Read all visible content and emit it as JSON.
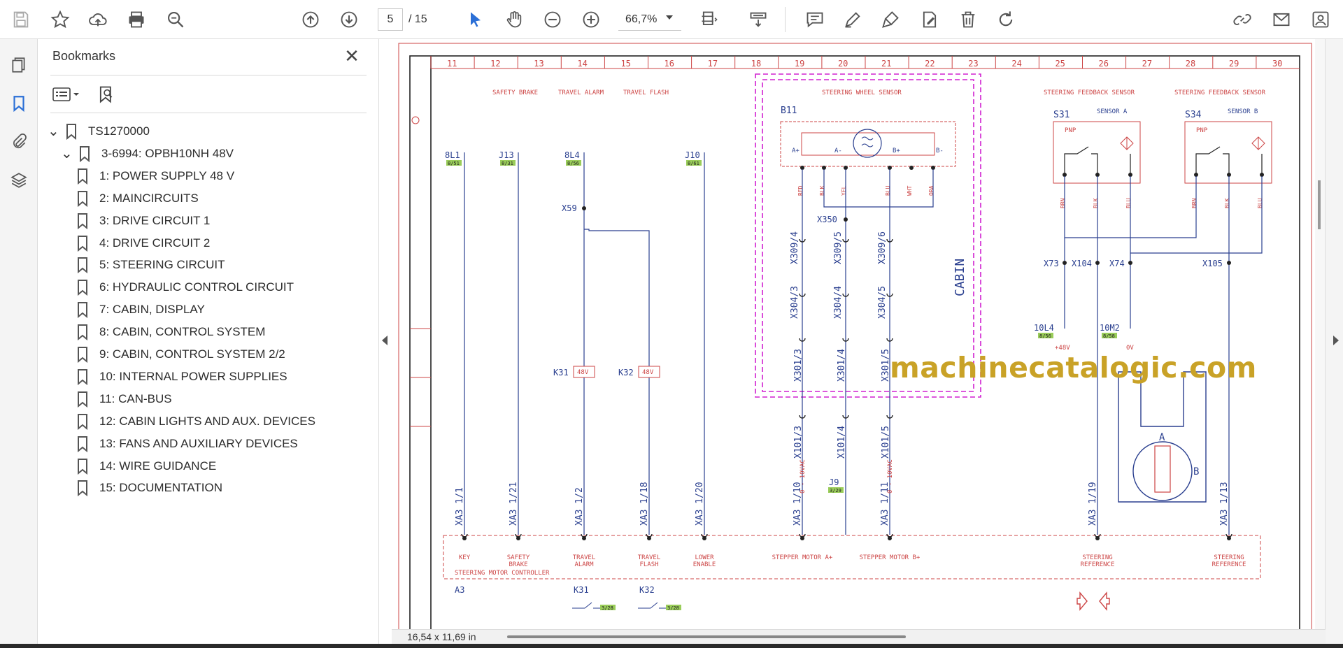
{
  "toolbar": {
    "page_current": "5",
    "page_total": "/ 15",
    "zoom": "66,7%",
    "icons": [
      "save-icon",
      "star-icon",
      "cloud-upload-icon",
      "print-icon",
      "zoom-search-icon",
      "prev-page-icon",
      "next-page-icon",
      "select-cursor-icon",
      "hand-icon",
      "zoom-out-icon",
      "zoom-in-icon",
      "fit-page-icon",
      "scan-icon",
      "comment-icon",
      "highlight-icon",
      "sign-icon",
      "edit-pdf-icon",
      "delete-icon",
      "rotate-icon",
      "share-link-icon",
      "email-icon",
      "user-icon"
    ]
  },
  "sidebar": {
    "title": "Bookmarks",
    "items": [
      {
        "label": "TS1270000",
        "level": 0,
        "expanded": true
      },
      {
        "label": "3-6994: OPBH10NH 48V",
        "level": 1,
        "expanded": true
      },
      {
        "label": "1: POWER SUPPLY 48 V",
        "level": 2
      },
      {
        "label": "2: MAINCIRCUITS",
        "level": 2
      },
      {
        "label": "3: DRIVE CIRCUIT 1",
        "level": 2
      },
      {
        "label": "4: DRIVE CIRCUIT 2",
        "level": 2
      },
      {
        "label": "5: STEERING CIRCUIT",
        "level": 2
      },
      {
        "label": "6: HYDRAULIC CONTROL CIRCUIT",
        "level": 2
      },
      {
        "label": "7: CABIN, DISPLAY",
        "level": 2
      },
      {
        "label": "8: CABIN, CONTROL SYSTEM",
        "level": 2
      },
      {
        "label": "9: CABIN, CONTROL SYSTEM 2/2",
        "level": 2
      },
      {
        "label": "10: INTERNAL POWER SUPPLIES",
        "level": 2
      },
      {
        "label": "11: CAN-BUS",
        "level": 2
      },
      {
        "label": "12: CABIN LIGHTS AND AUX. DEVICES",
        "level": 2
      },
      {
        "label": "13: FANS AND AUXILIARY DEVICES",
        "level": 2
      },
      {
        "label": "14: WIRE GUIDANCE",
        "level": 2
      },
      {
        "label": "15: DOCUMENTATION",
        "level": 2
      }
    ]
  },
  "status": {
    "page_size": "16,54 x 11,69 in"
  },
  "document": {
    "watermark": "machinecatalogic.com",
    "columns": [
      "11",
      "12",
      "13",
      "14",
      "15",
      "16",
      "17",
      "18",
      "19",
      "20",
      "21",
      "22",
      "23",
      "24",
      "25",
      "26",
      "27",
      "28",
      "29",
      "30"
    ],
    "headings": {
      "safety_brake": "SAFETY BRAKE",
      "travel_alarm": "TRAVEL ALARM",
      "travel_flash": "TRAVEL FLASH",
      "steering_wheel_sensor": "STEERING WHEEL SENSOR",
      "feedback_a": "STEERING FEEDBACK SENSOR",
      "feedback_b": "STEERING FEEDBACK SENSOR",
      "sensor_a": "SENSOR A",
      "sensor_b": "SENSOR B",
      "cabin": "CABIN",
      "controller": "STEERING MOTOR CONTROLLER"
    },
    "refs": {
      "r8L1": "8L1",
      "r8L1_tag": "8/51",
      "rJ13": "J13",
      "rJ13_tag": "8/31",
      "r8L4": "8L4",
      "r8L4_tag": "8/56",
      "rJ10": "J10",
      "rJ10_tag": "8/61",
      "x59": "X59",
      "b11": "B11",
      "s31": "S31",
      "s34": "S34",
      "x350": "X350",
      "x309_4": "X309/4",
      "x309_5": "X309/5",
      "x309_6": "X309/6",
      "x304_3": "X304/3",
      "x304_4": "X304/4",
      "x304_5": "X304/5",
      "x301_3": "X301/3",
      "x301_4": "X301/4",
      "x301_5": "X301/5",
      "x101_3": "X101/3",
      "x101_4": "X101/4",
      "x101_5": "X101/5",
      "k31": "K31",
      "k32": "K32",
      "k48v": "48V",
      "j9": "J9",
      "j9_tag": "3/29",
      "x73": "X73",
      "x104": "X104",
      "x74": "X74",
      "x105": "X105",
      "l10L4": "10L4",
      "l10L4_tag": "8/56",
      "p48v": "+48V",
      "m10M2": "10M2",
      "m10M2_tag": "8/58",
      "p0v": "0V",
      "a3": "A3",
      "k31b": "K31",
      "k31b_tag": "3/28",
      "k32b": "K32",
      "k32b_tag": "3/28",
      "pnp": "PNP",
      "pnp2": "PNP",
      "ring_a": "A",
      "ring_b": "B",
      "pin_a_plus": "A+",
      "pin_a_minus": "A-",
      "pin_b_plus": "B+",
      "pin_b_minus": "B-",
      "wire_red": "RED",
      "wire_blk": "BLK",
      "wire_yel": "YEL",
      "wire_blu": "BLU",
      "wire_wht": "WHT",
      "wire_ora": "ORA",
      "s_brn": "BRN",
      "s_blk": "BLK",
      "s_blu": "BLU",
      "vac1": "0 - 10VAC",
      "vac2": "0 - 10VAC"
    },
    "xa3": [
      {
        "pin": "XA3 1/1",
        "label1": "KEY",
        "label2": ""
      },
      {
        "pin": "XA3 1/21",
        "label1": "SAFETY",
        "label2": "BRAKE"
      },
      {
        "pin": "XA3 1/2",
        "label1": "TRAVEL",
        "label2": "ALARM"
      },
      {
        "pin": "XA3 1/18",
        "label1": "TRAVEL",
        "label2": "FLASH"
      },
      {
        "pin": "XA3 1/20",
        "label1": "LOWER",
        "label2": "ENABLE"
      },
      {
        "pin": "XA3 1/10",
        "label1": "STEPPER MOTOR A+",
        "label2": ""
      },
      {
        "pin": "XA3 1/11",
        "label1": "STEPPER MOTOR B+",
        "label2": ""
      },
      {
        "pin": "XA3 1/19",
        "label1": "STEERING",
        "label2": "REFERENCE"
      },
      {
        "pin": "XA3 1/13",
        "label1": "STEERING",
        "label2": "REFERENCE"
      }
    ]
  }
}
